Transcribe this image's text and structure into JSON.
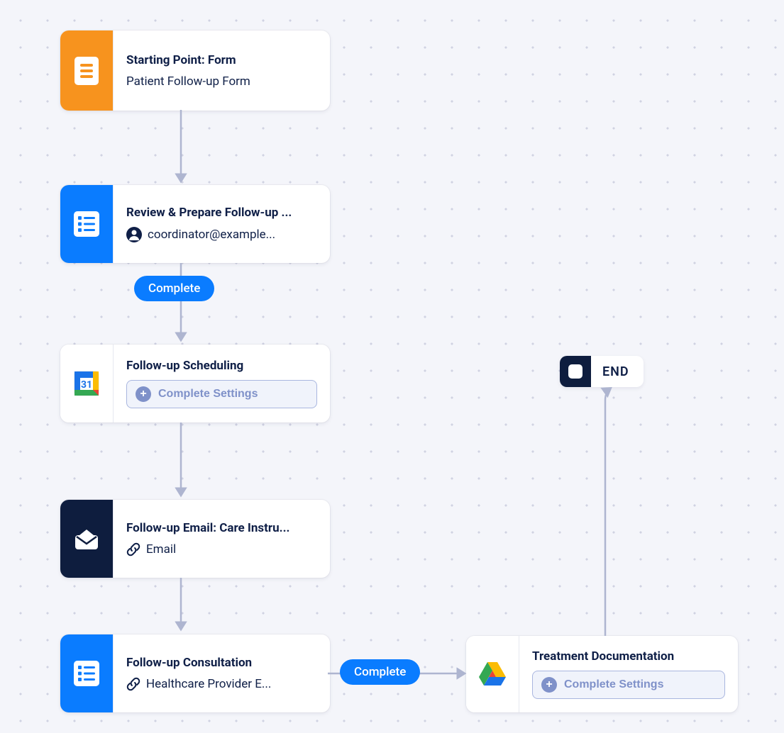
{
  "nodes": {
    "start": {
      "title": "Starting Point: Form",
      "subtitle": "Patient Follow-up Form",
      "icon": "form-icon",
      "icon_color": "orange"
    },
    "review": {
      "title": "Review & Prepare Follow-up ...",
      "assignee": "coordinator@example...",
      "icon": "checklist-icon",
      "icon_color": "blue"
    },
    "scheduling": {
      "title": "Follow-up Scheduling",
      "action_label": "Complete Settings",
      "icon": "google-calendar-icon",
      "icon_color": "white"
    },
    "email": {
      "title": "Follow-up Email: Care Instru...",
      "subtitle": "Email",
      "icon": "envelope-icon",
      "icon_color": "navy"
    },
    "consultation": {
      "title": "Follow-up Consultation",
      "subtitle": "Healthcare Provider E...",
      "icon": "checklist-icon",
      "icon_color": "blue"
    },
    "treatment": {
      "title": "Treatment Documentation",
      "action_label": "Complete Settings",
      "icon": "google-drive-icon",
      "icon_color": "white"
    },
    "end": {
      "label": "END"
    }
  },
  "edges": {
    "review_complete": {
      "label": "Complete"
    },
    "consultation_complete": {
      "label": "Complete"
    }
  }
}
